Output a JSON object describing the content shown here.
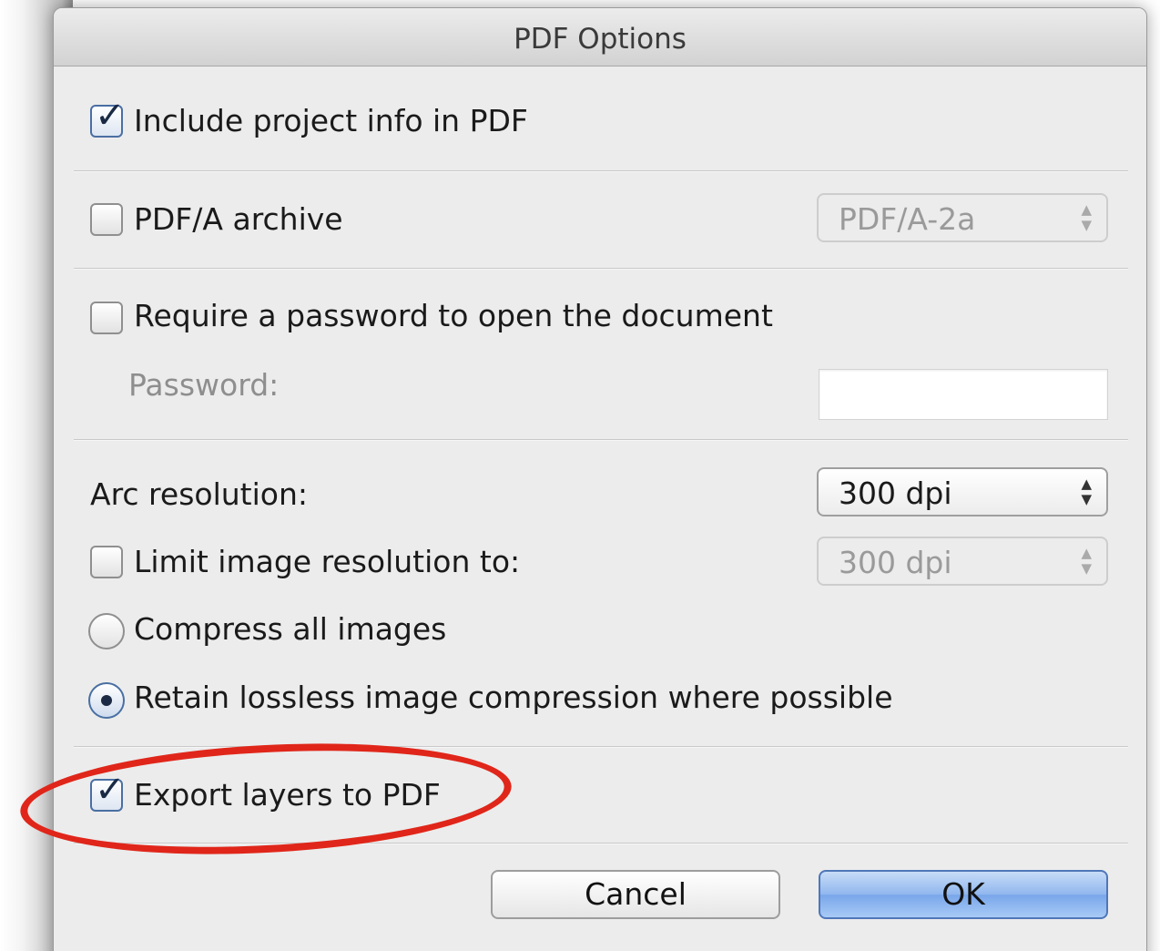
{
  "dialog": {
    "title": "PDF Options"
  },
  "options": {
    "include_project_info": {
      "label": "Include project info in PDF",
      "checked": true
    },
    "pdfa_archive": {
      "label": "PDF/A archive",
      "checked": false,
      "popup_value": "PDF/A-2a"
    },
    "require_password": {
      "label": "Require a password to open the document",
      "checked": false
    },
    "password": {
      "label": "Password:",
      "value": ""
    },
    "arc_resolution": {
      "label": "Arc resolution:",
      "value": "300 dpi"
    },
    "limit_image_resolution": {
      "label": "Limit image resolution to:",
      "checked": false,
      "value": "300 dpi"
    },
    "compress_all_images": {
      "label": "Compress all images",
      "selected": false
    },
    "retain_lossless": {
      "label": "Retain lossless image compression where possible",
      "selected": true
    },
    "export_layers": {
      "label": "Export layers to PDF",
      "checked": true
    }
  },
  "buttons": {
    "cancel": "Cancel",
    "ok": "OK"
  },
  "icons": {
    "checkmark": "✓",
    "popup_arrows": "▲▼"
  },
  "colors": {
    "annotation": "#e0261a",
    "default_button": "#90b7ee"
  }
}
